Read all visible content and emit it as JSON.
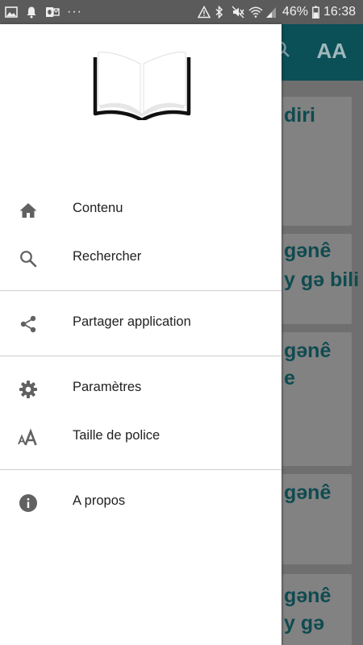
{
  "status_bar": {
    "battery_percent": "46%",
    "time": "16:38",
    "overflow": "···",
    "icons": [
      "image-icon",
      "bell-icon",
      "outlook-icon",
      "alert-triangle-icon",
      "bluetooth-icon",
      "mute-icon",
      "wifi-icon",
      "signal-icon",
      "battery-icon"
    ]
  },
  "background": {
    "font_size_button": "AA",
    "texts": [
      "diri",
      "gənê",
      "y gə bili",
      "gənê",
      "e",
      "gənê",
      "gənê",
      "y gə"
    ]
  },
  "drawer": {
    "logo": "open-book-icon",
    "items": [
      {
        "label": "Contenu",
        "icon": "home-icon"
      },
      {
        "label": "Rechercher",
        "icon": "search-icon"
      },
      {
        "label": "Partager application",
        "icon": "share-icon"
      },
      {
        "label": "Paramètres",
        "icon": "gear-icon"
      },
      {
        "label": "Taille de police",
        "icon": "font-size-icon"
      },
      {
        "label": "A propos",
        "icon": "info-icon"
      }
    ]
  },
  "colors": {
    "appbar": "#0b4f57",
    "icon_gray": "#616161",
    "text": "#212121",
    "divider": "#cfcfcf"
  }
}
